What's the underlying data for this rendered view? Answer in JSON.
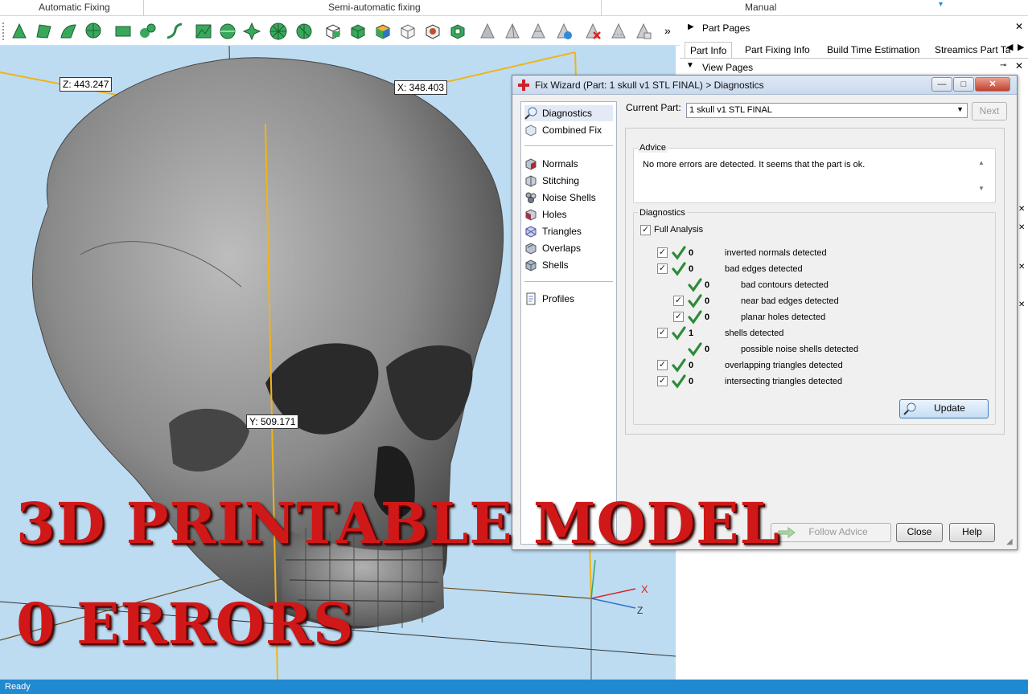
{
  "ribbon": {
    "groups": [
      "Automatic Fixing",
      "Semi-automatic fixing",
      "Manual"
    ]
  },
  "toolbar": {
    "more": "»"
  },
  "viewport": {
    "dim_z": "Z: 443.247",
    "dim_x": "X: 348.403",
    "dim_y": "Y: 509.171",
    "axis_x": "X",
    "axis_z": "Z"
  },
  "overlay": {
    "line1": "3D PRINTABLE MODEL",
    "line2": "0 ERRORS"
  },
  "right_panel": {
    "part_pages": "Part Pages",
    "tabs": [
      "Part Info",
      "Part Fixing Info",
      "Build Time Estimation",
      "Streamics Part Ta"
    ],
    "view_pages": "View Pages"
  },
  "dialog": {
    "title": "Fix Wizard (Part: 1 skull v1 STL FINAL) > Diagnostics",
    "nav": {
      "group1": [
        "Diagnostics",
        "Combined Fix"
      ],
      "group2": [
        "Normals",
        "Stitching",
        "Noise Shells",
        "Holes",
        "Triangles",
        "Overlaps",
        "Shells"
      ],
      "group3": [
        "Profiles"
      ]
    },
    "current_part_label": "Current Part:",
    "current_part_value": "1 skull v1 STL FINAL",
    "next_label": "Next",
    "advice_label": "Advice",
    "advice_text": "No more errors are detected. It seems that the part is ok.",
    "diagnostics_label": "Diagnostics",
    "full_analysis": "Full Analysis",
    "rows": [
      {
        "count": "0",
        "text": "inverted normals detected"
      },
      {
        "count": "0",
        "text": "bad edges detected"
      },
      {
        "count": "0",
        "text": "bad contours detected"
      },
      {
        "count": "0",
        "text": "near bad edges detected"
      },
      {
        "count": "0",
        "text": "planar holes detected"
      },
      {
        "count": "1",
        "text": "shells detected"
      },
      {
        "count": "0",
        "text": "possible noise shells detected"
      },
      {
        "count": "0",
        "text": "overlapping triangles detected"
      },
      {
        "count": "0",
        "text": "intersecting triangles detected"
      }
    ],
    "update_label": "Update",
    "follow_advice_label": "Follow Advice",
    "close_label": "Close",
    "help_label": "Help"
  },
  "status": {
    "text": "Ready"
  },
  "colors": {
    "accent": "#1f8ad0",
    "overlay_text": "#d01818",
    "viewport_bg": "#bddcf2",
    "check_green": "#2e8b3a"
  }
}
